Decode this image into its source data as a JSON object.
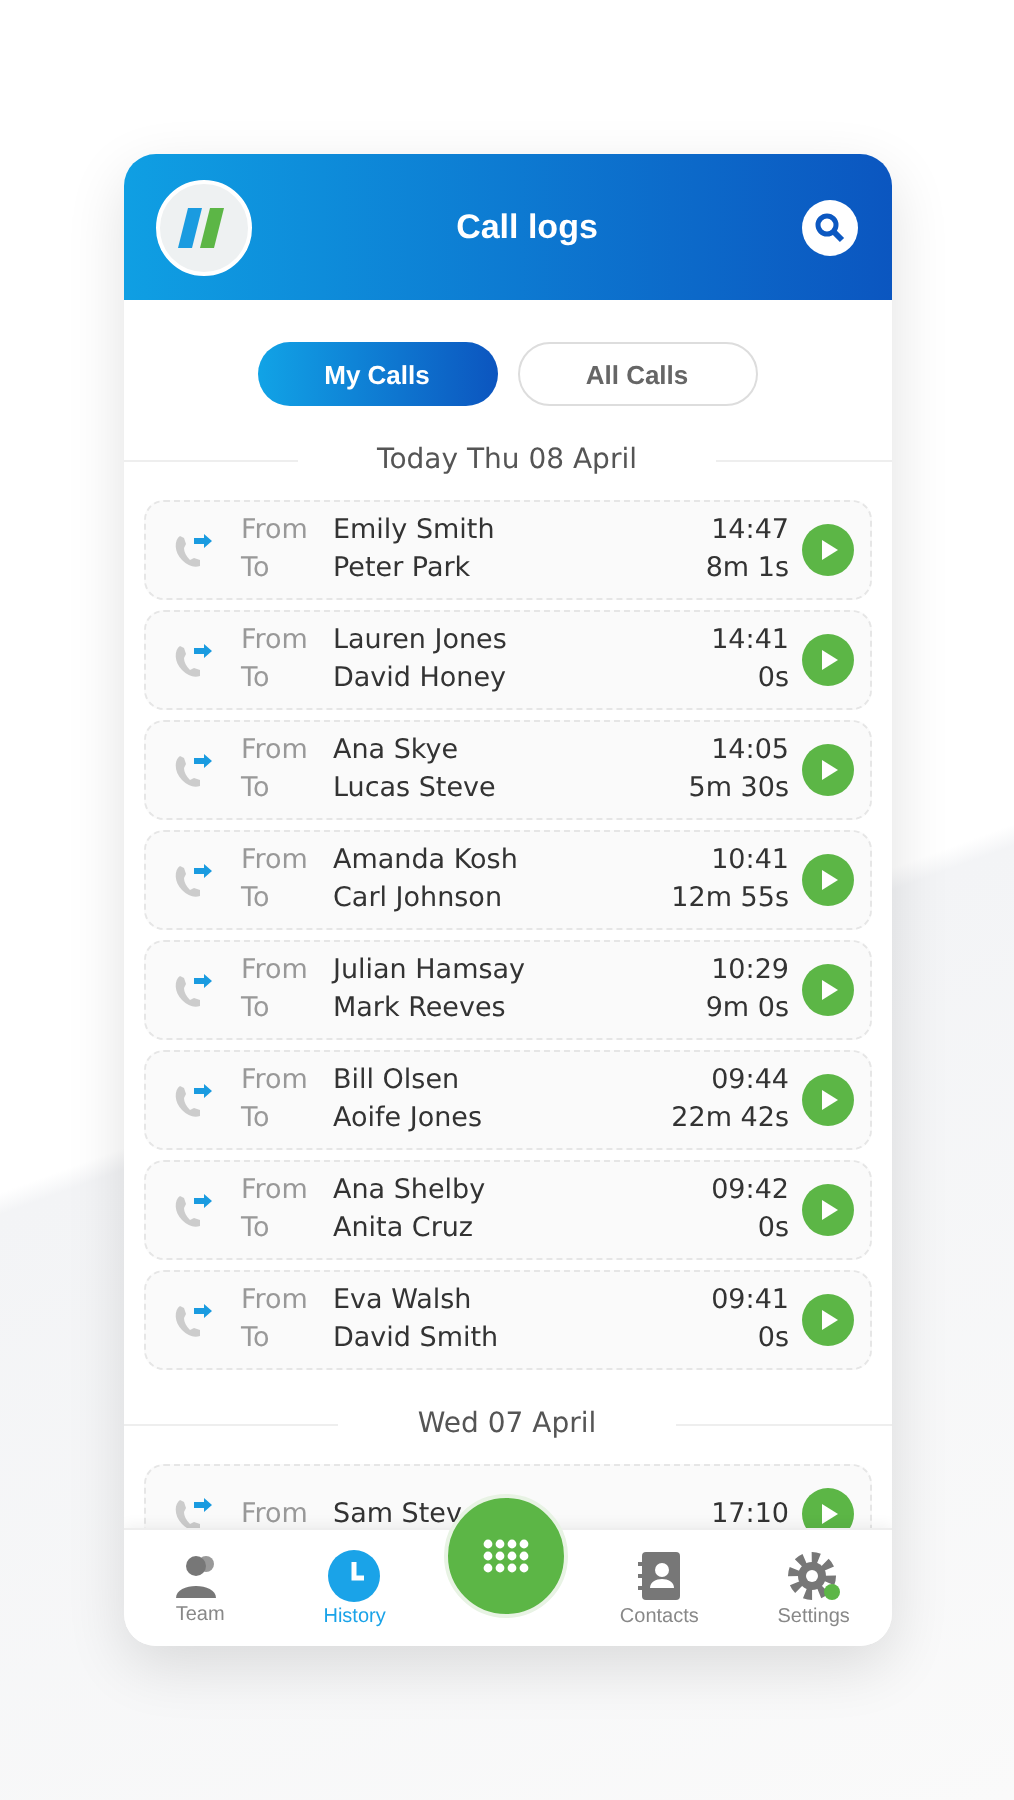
{
  "header": {
    "title": "Call logs"
  },
  "tabs": [
    {
      "label": "My Calls",
      "selected": true
    },
    {
      "label": "All Calls",
      "selected": false
    }
  ],
  "groups": [
    {
      "date": "Today Thu 08 April",
      "calls": [
        {
          "from_label": "From",
          "from": "Emily Smith",
          "to_label": "To",
          "to": "Peter Park",
          "time": "14:47",
          "duration": "8m 1s"
        },
        {
          "from_label": "From",
          "from": "Lauren Jones",
          "to_label": "To",
          "to": "David Honey",
          "time": "14:41",
          "duration": "0s"
        },
        {
          "from_label": "From",
          "from": "Ana Skye",
          "to_label": "To",
          "to": "Lucas Steve",
          "time": "14:05",
          "duration": "5m 30s"
        },
        {
          "from_label": "From",
          "from": "Amanda Kosh",
          "to_label": "To",
          "to": "Carl Johnson",
          "time": "10:41",
          "duration": "12m 55s"
        },
        {
          "from_label": "From",
          "from": "Julian Hamsay",
          "to_label": "To",
          "to": "Mark Reeves",
          "time": "10:29",
          "duration": "9m 0s"
        },
        {
          "from_label": "From",
          "from": "Bill Olsen",
          "to_label": "To",
          "to": "Aoife Jones",
          "time": "09:44",
          "duration": "22m 42s"
        },
        {
          "from_label": "From",
          "from": "Ana Shelby",
          "to_label": "To",
          "to": "Anita Cruz",
          "time": "09:42",
          "duration": "0s"
        },
        {
          "from_label": "From",
          "from": "Eva Walsh",
          "to_label": "To",
          "to": "David Smith",
          "time": "09:41",
          "duration": "0s"
        }
      ]
    },
    {
      "date": "Wed 07 April",
      "calls": [
        {
          "from_label": "From",
          "from": "Sam Stev",
          "time": "17:10"
        }
      ]
    }
  ],
  "nav": [
    {
      "label": "Team",
      "kind": "team",
      "selected": false
    },
    {
      "label": "History",
      "kind": "history",
      "selected": true
    },
    {
      "kind": "dial"
    },
    {
      "label": "Contacts",
      "kind": "contacts",
      "selected": false
    },
    {
      "label": "Settings",
      "kind": "settings",
      "selected": false
    }
  ]
}
